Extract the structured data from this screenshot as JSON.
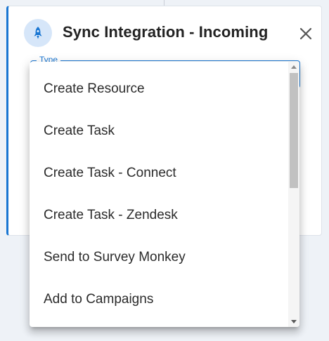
{
  "dialog": {
    "title": "Sync Integration - Incoming",
    "header_icon": "rocket-icon",
    "close_icon": "close-icon",
    "accent_color": "#1976d2",
    "icon_bg_color": "#d6e6f9"
  },
  "type_field": {
    "label": "Type"
  },
  "dropdown": {
    "options": [
      "Create Resource",
      "Create Task",
      "Create Task - Connect",
      "Create Task - Zendesk",
      "Send to Survey Monkey",
      "Add to Campaigns"
    ]
  }
}
